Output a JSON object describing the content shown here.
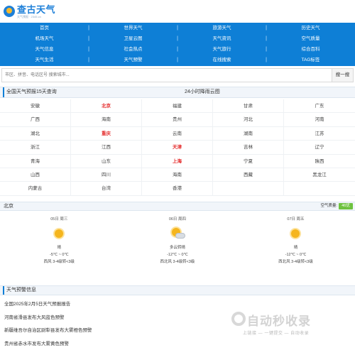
{
  "site": {
    "title": "查古天气",
    "subtitle": "天气预报 · 2345.cn"
  },
  "nav": {
    "rows": [
      [
        "首页",
        "世界天气",
        "旅游天气",
        "历史天气"
      ],
      [
        "机场天气",
        "卫星云图",
        "天气资讯",
        "空气质量"
      ],
      [
        "天气信息",
        "社会热点",
        "天气旅行",
        "综合百科"
      ],
      [
        "天气生活",
        "天气预警",
        "在线搜索",
        "TAG标签"
      ]
    ]
  },
  "search": {
    "placeholder": "市区、拼音、电话区号 搜索城市...",
    "button": "搜一搜"
  },
  "forecast_head": {
    "left": "全国天气预报15天查询",
    "center": "24小时降雨云图"
  },
  "provinces": [
    [
      {
        "name": "安徽",
        "hot": false
      },
      {
        "name": "北京",
        "hot": true
      },
      {
        "name": "福建",
        "hot": false
      },
      {
        "name": "甘肃",
        "hot": false
      },
      {
        "name": "广东",
        "hot": false
      }
    ],
    [
      {
        "name": "广西",
        "hot": false
      },
      {
        "name": "海南",
        "hot": false
      },
      {
        "name": "贵州",
        "hot": false
      },
      {
        "name": "河北",
        "hot": false
      },
      {
        "name": "河南",
        "hot": false
      }
    ],
    [
      {
        "name": "湖北",
        "hot": false
      },
      {
        "name": "重庆",
        "hot": true
      },
      {
        "name": "云南",
        "hot": false
      },
      {
        "name": "湖南",
        "hot": false
      },
      {
        "name": "江苏",
        "hot": false
      }
    ],
    [
      {
        "name": "浙江",
        "hot": false
      },
      {
        "name": "江西",
        "hot": false
      },
      {
        "name": "天津",
        "hot": true
      },
      {
        "name": "吉林",
        "hot": false
      },
      {
        "name": "辽宁",
        "hot": false
      }
    ],
    [
      {
        "name": "青海",
        "hot": false
      },
      {
        "name": "山东",
        "hot": false
      },
      {
        "name": "上海",
        "hot": true
      },
      {
        "name": "宁夏",
        "hot": false
      },
      {
        "name": "陕西",
        "hot": false
      }
    ],
    [
      {
        "name": "山西",
        "hot": false
      },
      {
        "name": "四川",
        "hot": false
      },
      {
        "name": "海南",
        "hot": false
      },
      {
        "name": "西藏",
        "hot": false
      },
      {
        "name": "黑龙江",
        "hot": false
      }
    ],
    [
      {
        "name": "内蒙古",
        "hot": false
      },
      {
        "name": "台湾",
        "hot": false
      },
      {
        "name": "香港",
        "hot": false
      },
      {
        "name": "",
        "hot": false
      },
      {
        "name": "",
        "hot": false
      }
    ]
  ],
  "city": {
    "name": "北京",
    "aqi_label": "空气质量:",
    "aqi_value": "46优"
  },
  "days": [
    {
      "date": "05日 周三",
      "icon": "sun-icon",
      "cond": "晴",
      "temp": "-5℃ ~ 0℃",
      "wind": "西风 3-4级转<3级"
    },
    {
      "date": "06日 周四",
      "icon": "partly-cloudy-icon",
      "cond": "多云转晴",
      "temp": "-12℃ ~ 0℃",
      "wind": "西北风 3-4级转<3级"
    },
    {
      "date": "07日 周五",
      "icon": "sun-icon",
      "cond": "晴",
      "temp": "-12℃ ~ 0℃",
      "wind": "西北风 3-4级转<3级"
    }
  ],
  "alerts_head": "天气预警信息",
  "alerts": [
    "全国2025年2月5日天气预报报告",
    "河南省滑县发布大风蓝色预警",
    "新疆维吾尔自治区尉犁县发布大雾橙色预警",
    "贵州省赤水市发布大雾黄色预警"
  ],
  "watermark": {
    "big": "自动秒收录",
    "small": "上链接 — 一键提交 — 自动收录"
  },
  "colors": {
    "nav_bg": "#0e7fd6",
    "hot_city": "#e42b2b",
    "aqi_good": "#6ec240"
  }
}
